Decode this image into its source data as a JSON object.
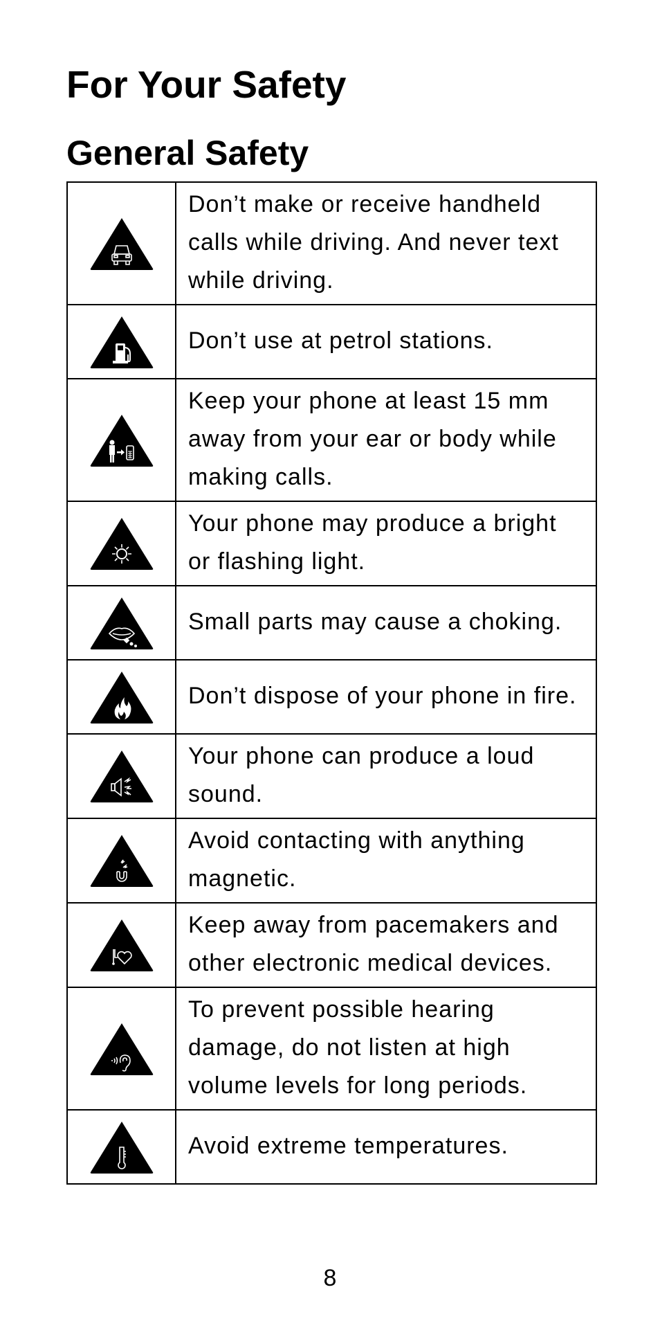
{
  "page": {
    "title": "For Your Safety",
    "section": "General Safety",
    "page_number": "8"
  },
  "safety_rows": [
    {
      "icon": "car-warning-icon",
      "lines": [
        "Don’t make or receive handheld",
        "calls while driving. And never text",
        "while driving."
      ]
    },
    {
      "icon": "petrol-pump-warning-icon",
      "lines": [
        "Don’t use at petrol stations."
      ]
    },
    {
      "icon": "body-distance-warning-icon",
      "lines": [
        "Keep your phone at least 15 mm",
        "away from your ear or body while",
        "making calls."
      ]
    },
    {
      "icon": "bright-light-warning-icon",
      "lines": [
        "Your phone may produce a bright",
        "or flashing light."
      ]
    },
    {
      "icon": "choking-hazard-warning-icon",
      "lines": [
        "Small parts may cause a choking."
      ]
    },
    {
      "icon": "fire-warning-icon",
      "lines": [
        "Don’t dispose of your phone in fire."
      ]
    },
    {
      "icon": "loud-sound-warning-icon",
      "lines": [
        "Your phone can produce a loud",
        "sound."
      ]
    },
    {
      "icon": "magnet-warning-icon",
      "lines": [
        "Avoid contacting with anything",
        "magnetic."
      ]
    },
    {
      "icon": "pacemaker-warning-icon",
      "lines": [
        "Keep away from pacemakers and",
        "other electronic medical devices."
      ]
    },
    {
      "icon": "hearing-damage-warning-icon",
      "lines": [
        "To prevent possible hearing",
        "damage, do not listen at high",
        "volume levels for long periods."
      ]
    },
    {
      "icon": "temperature-warning-icon",
      "lines": [
        "Avoid extreme temperatures."
      ]
    }
  ]
}
